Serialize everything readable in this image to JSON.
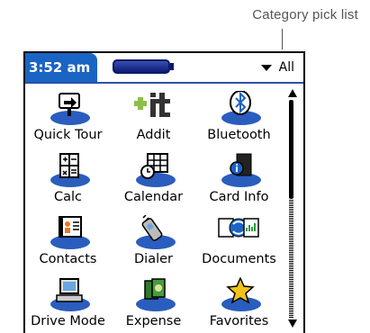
{
  "callout": {
    "text": "Category pick list"
  },
  "titlebar": {
    "time": "3:52 am",
    "category": "All"
  },
  "colors": {
    "time_tab": "#1a64c4",
    "icon_shadow": "#2a5dbe",
    "title_rule": "#3050a8"
  },
  "apps": [
    {
      "label": "Quick Tour",
      "icon": "quick-tour-icon"
    },
    {
      "label": "Addit",
      "icon": "addit-icon"
    },
    {
      "label": "Bluetooth",
      "icon": "bluetooth-icon"
    },
    {
      "label": "Calc",
      "icon": "calculator-icon"
    },
    {
      "label": "Calendar",
      "icon": "calendar-icon"
    },
    {
      "label": "Card Info",
      "icon": "card-info-icon"
    },
    {
      "label": "Contacts",
      "icon": "contacts-icon"
    },
    {
      "label": "Dialer",
      "icon": "phone-icon"
    },
    {
      "label": "Documents",
      "icon": "documents-icon"
    },
    {
      "label": "Drive Mode",
      "icon": "computer-icon"
    },
    {
      "label": "Expense",
      "icon": "expense-icon"
    },
    {
      "label": "Favorites",
      "icon": "star-icon"
    }
  ]
}
